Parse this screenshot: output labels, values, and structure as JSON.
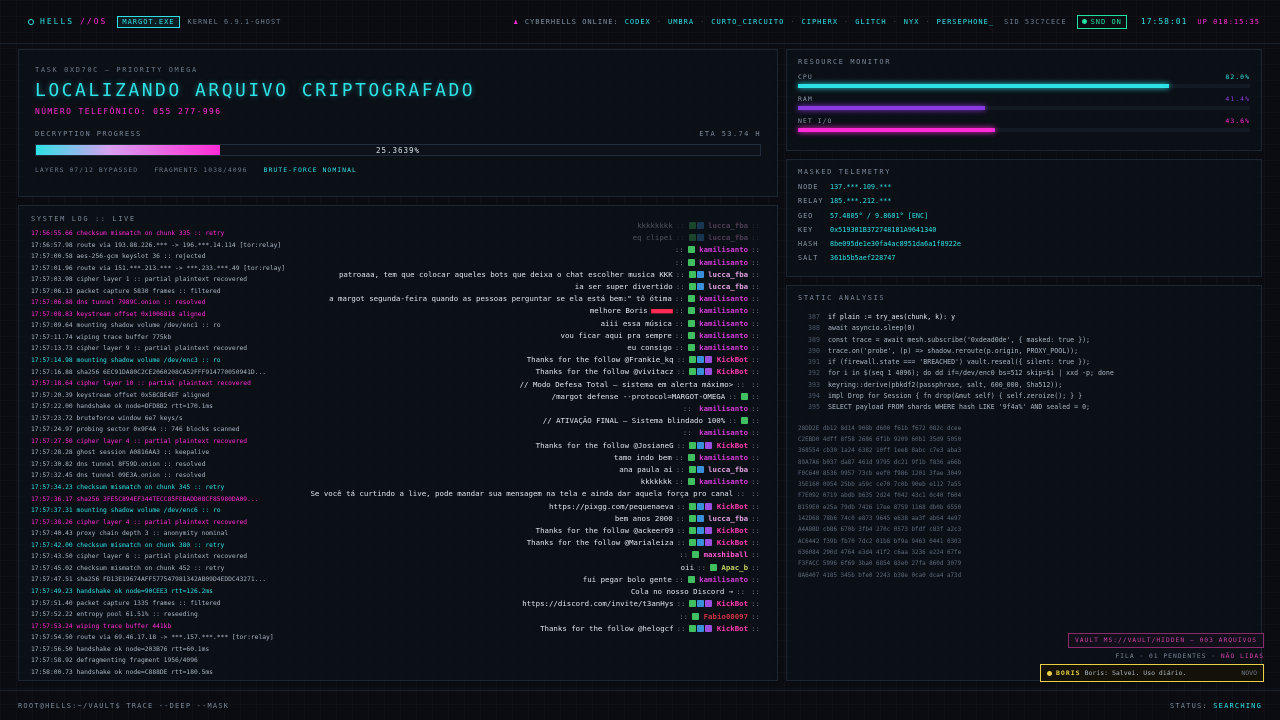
{
  "topbar": {
    "logo": "HELLS",
    "logo_os": "//OS",
    "badge": "MARGOT.EXE",
    "kernel": "KERNEL 6.9.1-GHOST",
    "online_label": "CYBERHELLS ONLINE:",
    "online_users": [
      "CODEX",
      "UMBRA",
      "CURTO_CIRCUITO",
      "CIPHERX",
      "GLITCH",
      "NYX",
      "PERSEPHONE_"
    ],
    "sid": "SID 53C7CECE",
    "snd": "SND ON",
    "clock": "17:58:01",
    "uptime": "UP 018:15:35"
  },
  "task": {
    "id": "TASK 0XD70C — PRIORITY OMEGA",
    "title": "LOCALIZANDO ARQUIVO CRIPTOGRAFADO",
    "phone": "NÚMERO TELEFÔNICO: 055 277-996",
    "progress_label": "DECRYPTION PROGRESS",
    "eta": "ETA 53.74 H",
    "progress_pct": 25.3639,
    "progress_text": "25.3639%",
    "layers": "LAYERS 07/12 BYPASSED",
    "fragments": "FRAGMENTS 1038/4096",
    "brute": "BRUTE-FORCE NOMINAL"
  },
  "syslog": {
    "title": "SYSTEM LOG :: LIVE",
    "lines": [
      {
        "t": "17:56:55.66  checksum mismatch on chunk 335 :: retry",
        "c": "m"
      },
      {
        "t": "17:56:57.98  route via 193.88.226.*** -> 196.***.14.114 [tor:relay]",
        "c": ""
      },
      {
        "t": "17:57:00.58  aes-256-gcm keyslot 36 :: rejected",
        "c": ""
      },
      {
        "t": "17:57:01.96  route via 151.***.213.*** -> ***.233.***.49 [tor:relay]",
        "c": ""
      },
      {
        "t": "17:57:03.98  cipher layer 1 :: partial plaintext recovered",
        "c": ""
      },
      {
        "t": "17:57:06.13  packet capture 5830 frames :: filtered",
        "c": ""
      },
      {
        "t": "17:57:06.88  dns tunnel 7989C.onion :: resolved",
        "c": "m"
      },
      {
        "t": "17:57:08.83  keystream offset 0x1006818 aligned",
        "c": "m"
      },
      {
        "t": "17:57:09.64  mounting shadow volume /dev/enc1 :: ro",
        "c": ""
      },
      {
        "t": "17:57:11.74  wiping trace buffer 775kb",
        "c": ""
      },
      {
        "t": "17:57:13.73  cipher layer 9 :: partial plaintext recovered",
        "c": ""
      },
      {
        "t": "17:57:14.98  mounting shadow volume /dev/enc3 :: ro",
        "c": "c"
      },
      {
        "t": "17:57:16.88  sha256 6EC91DA80C2CE2060208CA52FFF914770050941D...",
        "c": ""
      },
      {
        "t": "17:57:18.64  cipher layer 10 :: partial plaintext recovered",
        "c": "m"
      },
      {
        "t": "17:57:20.39  keystream offset 0x5BCBE4EF aligned",
        "c": ""
      },
      {
        "t": "17:57:22.00  handshake ok node=DFD8B2 rtt=170.1ms",
        "c": ""
      },
      {
        "t": "17:57:23.72  bruteforce window 6e7 keys/s",
        "c": ""
      },
      {
        "t": "17:57:24.97  probing sector 0x9F4A :: 746 blocks scanned",
        "c": ""
      },
      {
        "t": "17:57:27.50  cipher layer 4 :: partial plaintext recovered",
        "c": "m"
      },
      {
        "t": "17:57:28.28  ghost session A0816AA3 :: keepalive",
        "c": ""
      },
      {
        "t": "17:57:30.82  dns tunnel 8F59D.onion :: resolved",
        "c": ""
      },
      {
        "t": "17:57:32.45  dns tunnel 09E3A.onion :: resolved",
        "c": ""
      },
      {
        "t": "17:57:34.23  checksum mismatch on chunk 345 :: retry",
        "c": "c"
      },
      {
        "t": "17:57:36.17  sha256 3FE5C894EF344TECC85FEBADD08CF85980DA09...",
        "c": "m"
      },
      {
        "t": "17:57:37.31  mounting shadow volume /dev/enc6 :: ro",
        "c": "c"
      },
      {
        "t": "17:57:38.26  cipher layer 4 :: partial plaintext recovered",
        "c": "m"
      },
      {
        "t": "17:57:40.43  proxy chain depth 3 :: anonymity nominal",
        "c": ""
      },
      {
        "t": "17:57:42.00  checksum mismatch on chunk 380 :: retry",
        "c": "c"
      },
      {
        "t": "17:57:43.50  cipher layer 6 :: partial plaintext recovered",
        "c": ""
      },
      {
        "t": "17:57:45.02  checksum mismatch on chunk 452 :: retry",
        "c": ""
      },
      {
        "t": "17:57:47.51  sha256 FD13E19674AFF577547981342AB09D4EDDC43271...",
        "c": ""
      },
      {
        "t": "17:57:49.23  handshake ok node=90CEE3 rtt=126.2ms",
        "c": "c"
      },
      {
        "t": "17:57:51.40  packet capture 1335 frames :: filtered",
        "c": ""
      },
      {
        "t": "17:57:52.22  entropy pool 61.51% :: reseeding",
        "c": ""
      },
      {
        "t": "17:57:53.24  wiping trace buffer 441kb",
        "c": "m"
      },
      {
        "t": "17:57:54.50  route via 69.46.17.18 -> ***.157.***.*** [tor:relay]",
        "c": ""
      },
      {
        "t": "17:57:56.50  handshake ok node=203B76 rtt=60.1ms",
        "c": ""
      },
      {
        "t": "17:57:58.92  defragmenting fragment 1956/4096",
        "c": ""
      },
      {
        "t": "17:58:00.73  handshake ok node=C888DE rtt=180.5ms",
        "c": ""
      }
    ]
  },
  "chat": [
    {
      "text": "kkkkkkkk",
      "user": "lucca_fba",
      "icons": [
        "g",
        "b"
      ],
      "cls": "u4",
      "faded": true
    },
    {
      "text": "eq clipei",
      "user": "lucca_fba",
      "icons": [
        "g",
        "b"
      ],
      "cls": "u4",
      "faded": true
    },
    {
      "text": "",
      "user": "kamilisanto",
      "icons": [
        "g"
      ],
      "cls": "u1"
    },
    {
      "text": "",
      "user": "kamilisanto",
      "icons": [
        "g"
      ],
      "cls": "u1"
    },
    {
      "text": "patroaaa, tem que colocar aqueles bots que deixa o chat escolher musica KKK",
      "user": "lucca_fba",
      "icons": [
        "g",
        "b"
      ],
      "cls": "u4"
    },
    {
      "text": "ia ser super divertido",
      "user": "lucca_fba",
      "icons": [
        "g",
        "b"
      ],
      "cls": "u4"
    },
    {
      "text": "a margot segunda-feira quando as pessoas perguntar se ela está bem:\" tô ótima",
      "user": "kamilisanto",
      "icons": [
        "g"
      ],
      "cls": "u1"
    },
    {
      "text": "melhore Boris",
      "user": "kamilisanto",
      "icons": [
        "g"
      ],
      "cls": "u1",
      "hearts": true
    },
    {
      "text": "aiii essa música",
      "user": "kamilisanto",
      "icons": [
        "g"
      ],
      "cls": "u1"
    },
    {
      "text": "vou ficar aqui pra sempre",
      "user": "kamilisanto",
      "icons": [
        "g"
      ],
      "cls": "u1"
    },
    {
      "text": "eu consigo",
      "user": "kamilisanto",
      "icons": [
        "g"
      ],
      "cls": "u1"
    },
    {
      "text": "Thanks for the follow @Frankie_kq",
      "user": "KickBot",
      "icons": [
        "g",
        "b",
        "p"
      ],
      "cls": "u3"
    },
    {
      "text": "Thanks for the follow @vivitacz",
      "user": "KickBot",
      "icons": [
        "g",
        "b",
        "p"
      ],
      "cls": "u3"
    },
    {
      "text": "// Modo Defesa Total — sistema em alerta máximo>",
      "user": "",
      "icons": [],
      "cls": "",
      "sys": true
    },
    {
      "text": "/margot defense --protocol=MARGOT-OMEGA",
      "user": "",
      "icons": [
        "g"
      ],
      "cls": "",
      "sys": true
    },
    {
      "text": "",
      "user": "kamilisanto",
      "icons": [],
      "cls": "u1"
    },
    {
      "text": "// ATIVAÇÃO FINAL — Sistema blindado 100%",
      "user": "",
      "icons": [
        "g"
      ],
      "cls": "",
      "sys": true
    },
    {
      "text": "",
      "user": "kamilisanto",
      "icons": [],
      "cls": "u1"
    },
    {
      "text": "Thanks for the follow @JosianeG",
      "user": "KickBot",
      "icons": [
        "g",
        "b",
        "p"
      ],
      "cls": "u3"
    },
    {
      "text": "tamo indo bem",
      "user": "kamilisanto",
      "icons": [
        "g"
      ],
      "cls": "u1"
    },
    {
      "text": "ana paula ai",
      "user": "lucca_fba",
      "icons": [
        "g",
        "b"
      ],
      "cls": "u4"
    },
    {
      "text": "kkkkkkk",
      "user": "kamilisanto",
      "icons": [
        "g"
      ],
      "cls": "u1"
    },
    {
      "text": "Se você tá curtindo a live, pode mandar sua mensagem na tela e ainda dar aquela força pro canal",
      "user": "",
      "icons": [],
      "cls": "",
      "sys": true,
      "wrap": true
    },
    {
      "text": "https://pixgg.com/pequenaeva",
      "user": "KickBot",
      "icons": [
        "g",
        "b",
        "p"
      ],
      "cls": "u3"
    },
    {
      "text": "bem anos 2000",
      "user": "lucca_fba",
      "icons": [
        "g",
        "b"
      ],
      "cls": "u4"
    },
    {
      "text": "Thanks for the follow @ackeer09",
      "user": "KickBot",
      "icons": [
        "g",
        "b",
        "p"
      ],
      "cls": "u3"
    },
    {
      "text": "Thanks for the follow @Marialeiza",
      "user": "KickBot",
      "icons": [
        "g",
        "b",
        "p"
      ],
      "cls": "u3"
    },
    {
      "text": "",
      "user": "maxshiball",
      "icons": [
        "g"
      ],
      "cls": "u6"
    },
    {
      "text": "oii",
      "user": "Apac_b",
      "icons": [
        "g"
      ],
      "cls": "u5"
    },
    {
      "text": "fui pegar bolo gente",
      "user": "kamilisanto",
      "icons": [
        "g"
      ],
      "cls": "u1"
    },
    {
      "text": "Cola no nosso Discord →",
      "user": "",
      "icons": [],
      "cls": "",
      "sys": true
    },
    {
      "text": "https://discord.com/invite/t3anHys",
      "user": "KickBot",
      "icons": [
        "g",
        "b",
        "p"
      ],
      "cls": "u3"
    },
    {
      "text": "",
      "user": "Fabio00097",
      "icons": [
        "g"
      ],
      "cls": "u7"
    },
    {
      "text": "Thanks for the follow @helogcf",
      "user": "KickBot",
      "icons": [
        "g",
        "b",
        "p"
      ],
      "cls": "u3"
    }
  ],
  "resmon": {
    "title": "RESOURCE MONITOR",
    "items": [
      {
        "label": "CPU",
        "pct": 82.0,
        "text": "82.0%",
        "color": "#2de2e6"
      },
      {
        "label": "RAM",
        "pct": 41.4,
        "text": "41.4%",
        "color": "#8a3ae0"
      },
      {
        "label": "NET I/O",
        "pct": 43.6,
        "text": "43.6%",
        "color": "#ff2bd6"
      }
    ]
  },
  "telemetry": {
    "title": "MASKED TELEMETRY",
    "rows": [
      {
        "k": "NODE",
        "v": "137.***.109.***"
      },
      {
        "k": "RELAY",
        "v": "185.***.212.***"
      },
      {
        "k": "GEO",
        "v": "57.4805° / 9.8601° [ENC]"
      },
      {
        "k": "KEY",
        "v": "0x519301B372748181A9641340"
      },
      {
        "k": "HASH",
        "v": "8be095de1e30fa4ac8951da6a1f8922e"
      },
      {
        "k": "SALT",
        "v": "361b5b5aef228747"
      }
    ]
  },
  "static": {
    "title": "STATIC ANALYSIS",
    "code": [
      {
        "n": "387",
        "c": "if plain := try_aes(chunk, k): y",
        "hl": true
      },
      {
        "n": "388",
        "c": "await asyncio.sleep(0)"
      },
      {
        "n": "389",
        "c": "const trace = await mesh.subscribe('0xdead0de', { masked: true });"
      },
      {
        "n": "390",
        "c": "trace.on('probe', (p) => shadow.reroute(p.origin, PROXY_POOL));"
      },
      {
        "n": "391",
        "c": "if (firewall.state === 'BREACHED') vault.reseal({ silent: true });"
      },
      {
        "n": "392",
        "c": "for i in $(seq 1 4096); do dd if=/dev/enc0 bs=512 skip=$i | xxd -p; done"
      },
      {
        "n": "393",
        "c": "keyring::derive(pbkdf2(passphrase, salt, 600_000, Sha512));"
      },
      {
        "n": "394",
        "c": "impl Drop for Session { fn drop(&mut self) { self.zeroize(); } }"
      },
      {
        "n": "395",
        "c": "SELECT payload FROM shards WHERE hash LIKE '9f4a%' AND sealed = 0;"
      }
    ],
    "hex": [
      "28DD2E db12 8d14 908b d600 f61b f672 082c dcee",
      "C2EBD0 4dff 8f58 2686 6f1b 9209 60b1 35d9 5050",
      "368554 cb30 1a24 6382 10ff 1ee8 8abc c7e3 aba3",
      "89A7A6 b037 da87 461d 9795 dc21 9f1b f836 a66b",
      "F0C640 8536 9957 73cb eef0 f986 1201 3fae 3049",
      "35E160 0954 25bb a59c ce70 7c0b 90eb e112 7a55",
      "F7E092 0719 abdb b635 2d24 f042 43c1 0c40 f604",
      "B159E0 e25a 79db 7426 17ee 8759 1168 db0b 6550",
      "142D68 78b6 74c0 e873 9645 e638 aa3f ab64 4e97",
      "A4A8BD cb86 670b 3fb4 270c 0573 bfdf c83f a2c3",
      "AC6442 f39b fb70 7dc2 01b8 bf9a 9463 0441 0303",
      "636084 290d 4764 e3d4 41f2 c6aa 3236 e224 67fe",
      "F3FACC 5996 6f69 3ba0 6854 83e0 27fa 860d 3079",
      "8A6407 4185 345b bfe0 2243 b38e 0ca0 dca4 a73d"
    ]
  },
  "vault": "VAULT MS://VAULT/HIDDEN — 003 ARQUIVOS",
  "fila": {
    "label": "FILA · 01 PENDENTES ·",
    "value": "NÃO LIDAS"
  },
  "toast": {
    "name": "BORIS",
    "msg": "Boris: Salvei. Uso diário.",
    "time": "NOVO"
  },
  "bottombar": {
    "prompt": "ROOT@HELLS:~/VAULT$ TRACE --DEEP --MASK",
    "status_label": "STATUS:",
    "status_value": "SEARCHING"
  }
}
